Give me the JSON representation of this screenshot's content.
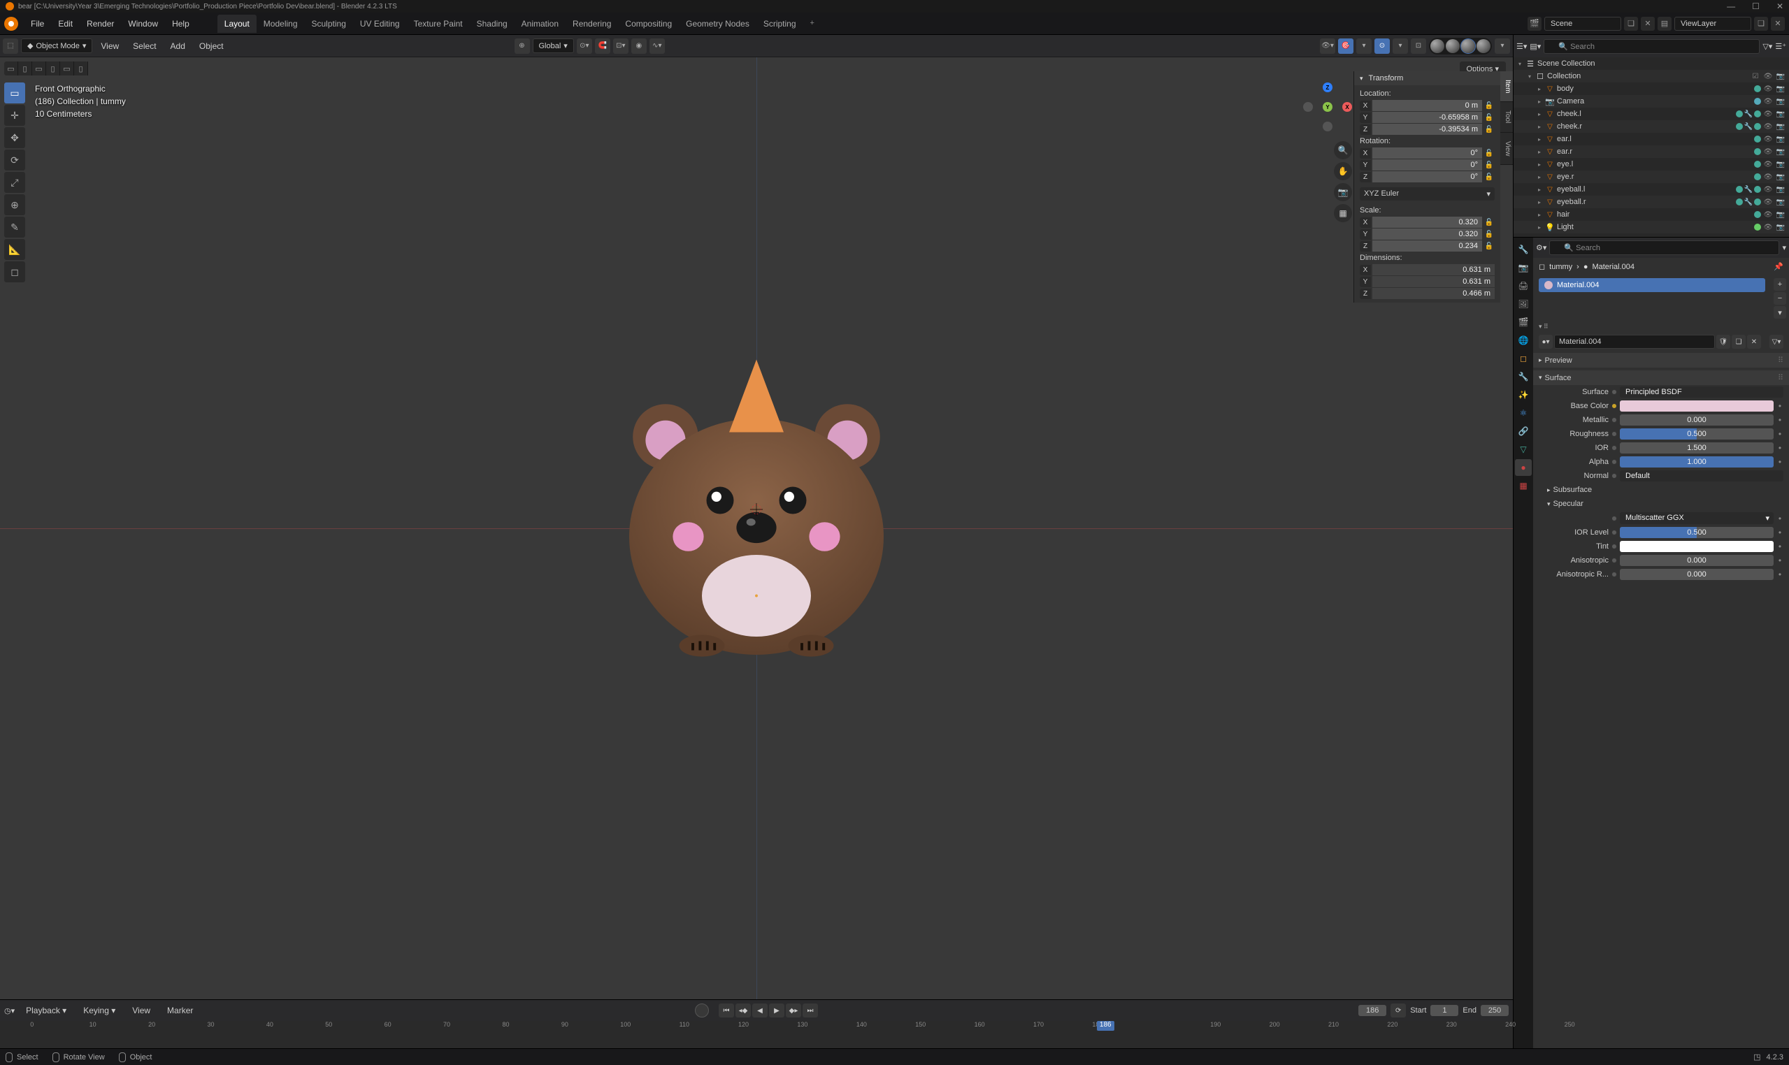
{
  "titlebar": {
    "text": "bear [C:\\University\\Year 3\\Emerging Technologies\\Portfolio_Production Piece\\Portfolio Dev\\bear.blend] - Blender 4.2.3 LTS"
  },
  "topmenu": {
    "items": [
      "File",
      "Edit",
      "Render",
      "Window",
      "Help"
    ],
    "tabs": [
      "Layout",
      "Modeling",
      "Sculpting",
      "UV Editing",
      "Texture Paint",
      "Shading",
      "Animation",
      "Rendering",
      "Compositing",
      "Geometry Nodes",
      "Scripting"
    ],
    "active_tab": 0,
    "scene_label": "Scene",
    "layer_label": "ViewLayer"
  },
  "viewport_header": {
    "mode": "Object Mode",
    "menus": [
      "View",
      "Select",
      "Add",
      "Object"
    ],
    "orientation": "Global",
    "options": "Options"
  },
  "viewport_info": {
    "line1": "Front Orthographic",
    "line2": "(186) Collection | tummy",
    "line3": "10 Centimeters"
  },
  "npanel": {
    "transform": "Transform",
    "location": "Location:",
    "loc": {
      "x": "0 m",
      "y": "-0.65958 m",
      "z": "-0.39534 m"
    },
    "rotation": "Rotation:",
    "rot": {
      "x": "0°",
      "y": "0°",
      "z": "0°"
    },
    "rot_mode": "XYZ Euler",
    "scale": "Scale:",
    "scl": {
      "x": "0.320",
      "y": "0.320",
      "z": "0.234"
    },
    "dimensions": "Dimensions:",
    "dim": {
      "x": "0.631 m",
      "y": "0.631 m",
      "z": "0.466 m"
    },
    "tabs": [
      "Item",
      "Tool",
      "View"
    ]
  },
  "outliner": {
    "search_placeholder": "Search",
    "root": "Scene Collection",
    "collection": "Collection",
    "items": [
      {
        "name": "body",
        "type": "mesh"
      },
      {
        "name": "Camera",
        "type": "camera"
      },
      {
        "name": "cheek.l",
        "type": "mesh",
        "mods": true
      },
      {
        "name": "cheek.r",
        "type": "mesh",
        "mods": true
      },
      {
        "name": "ear.l",
        "type": "mesh"
      },
      {
        "name": "ear.r",
        "type": "mesh"
      },
      {
        "name": "eye.l",
        "type": "mesh"
      },
      {
        "name": "eye.r",
        "type": "mesh"
      },
      {
        "name": "eyeball.l",
        "type": "mesh",
        "mods": true
      },
      {
        "name": "eyeball.r",
        "type": "mesh",
        "mods": true
      },
      {
        "name": "hair",
        "type": "mesh"
      },
      {
        "name": "Light",
        "type": "light"
      }
    ]
  },
  "properties": {
    "search_placeholder": "Search",
    "breadcrumb_obj": "tummy",
    "breadcrumb_mat": "Material.004",
    "slot_name": "Material.004",
    "mat_name": "Material.004",
    "preview": "Preview",
    "surface": "Surface",
    "surface_label": "Surface",
    "surface_val": "Principled BSDF",
    "base_color": "Base Color",
    "metallic": "Metallic",
    "metallic_val": "0.000",
    "roughness": "Roughness",
    "roughness_val": "0.500",
    "ior": "IOR",
    "ior_val": "1.500",
    "alpha": "Alpha",
    "alpha_val": "1.000",
    "normal": "Normal",
    "normal_val": "Default",
    "subsurface": "Subsurface",
    "specular": "Specular",
    "specular_dist": "Multiscatter GGX",
    "ior_level": "IOR Level",
    "ior_level_val": "0.500",
    "tint": "Tint",
    "anisotropic": "Anisotropic",
    "anisotropic_val": "0.000",
    "anisotropic_r": "Anisotropic R...",
    "anisotropic_r_val": "0.000"
  },
  "timeline": {
    "menus": [
      "Playback",
      "Keying",
      "View",
      "Marker"
    ],
    "current": "186",
    "start_label": "Start",
    "start": "1",
    "end_label": "End",
    "end": "250",
    "ticks": [
      "0",
      "10",
      "20",
      "30",
      "40",
      "50",
      "60",
      "70",
      "80",
      "90",
      "100",
      "110",
      "120",
      "130",
      "140",
      "150",
      "160",
      "170",
      "180",
      "186",
      "190",
      "200",
      "210",
      "220",
      "230",
      "240",
      "250"
    ]
  },
  "statusbar": {
    "select": "Select",
    "rotate": "Rotate View",
    "object": "Object",
    "version": "4.2.3"
  }
}
